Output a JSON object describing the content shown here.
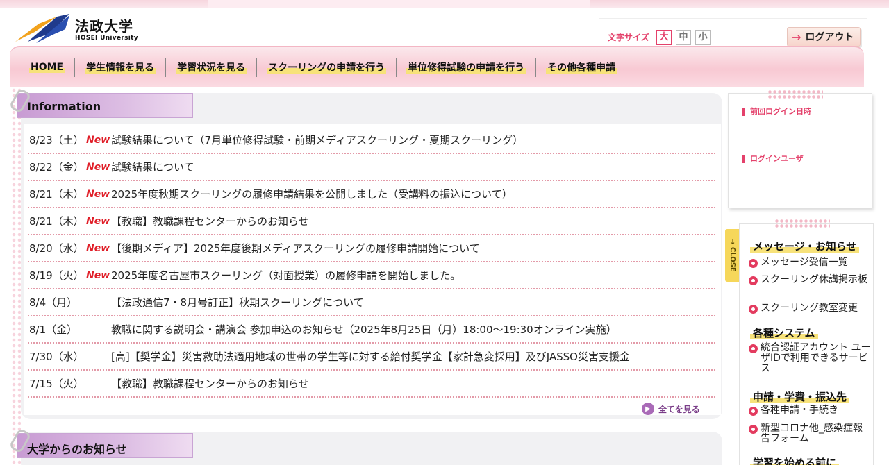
{
  "header": {
    "logo_main": "法政大学",
    "logo_sub": "HOSEI University",
    "fontsize_label": "文字サイズ",
    "fontsize_options": [
      "大",
      "中",
      "小"
    ],
    "logout_label": "ログアウト"
  },
  "nav": {
    "items": [
      {
        "label": "HOME"
      },
      {
        "label": "学生情報を見る"
      },
      {
        "label": "学習状況を見る"
      },
      {
        "label": "スクーリングの申請を行う"
      },
      {
        "label": "単位修得試験の申請を行う"
      },
      {
        "label": "その他各種申請"
      }
    ]
  },
  "information": {
    "heading": "Information",
    "new_badge": "New",
    "items": [
      {
        "date": "8/23（土）",
        "is_new": true,
        "title": "試験結果について（7月単位修得試験・前期メディアスクーリング・夏期スクーリング）"
      },
      {
        "date": "8/22（金）",
        "is_new": true,
        "title": "試験結果について"
      },
      {
        "date": "8/21（木）",
        "is_new": true,
        "title": "2025年度秋期スクーリングの履修申請結果を公開しました（受講料の振込について）"
      },
      {
        "date": "8/21（木）",
        "is_new": true,
        "title": "【教職】教職課程センターからのお知らせ"
      },
      {
        "date": "8/20（水）",
        "is_new": true,
        "title": "【後期メディア】2025年度後期メディアスクーリングの履修申請開始について"
      },
      {
        "date": "8/19（火）",
        "is_new": true,
        "title": "2025年度名古屋市スクーリング（対面授業）の履修申請を開始しました。"
      },
      {
        "date": "8/4（月）",
        "is_new": false,
        "title": "【法政通信7・8月号訂正】秋期スクーリングについて"
      },
      {
        "date": "8/1（金）",
        "is_new": false,
        "title": "教職に関する説明会・講演会 参加申込のお知らせ（2025年8月25日（月）18:00〜19:30オンライン実施）"
      },
      {
        "date": "7/30（水）",
        "is_new": false,
        "title": "[高]【奨学金】災害救助法適用地域の世帯の学生等に対する給付奨学金【家計急変採用】及びJASSO災害支援金"
      },
      {
        "date": "7/15（火）",
        "is_new": false,
        "title": "【教職】教職課程センターからのお知らせ"
      }
    ],
    "see_all": "全てを見る"
  },
  "university_news": {
    "heading": "大学からのお知らせ"
  },
  "login_card": {
    "last_login_label": "前回ログイン日時",
    "login_user_label": "ログインユーザ"
  },
  "close_tab": "→ CLOSE",
  "side_menu": {
    "sections": [
      {
        "heading": "メッセージ・お知らせ",
        "links": [
          "メッセージ受信一覧",
          "スクーリング休講掲示板",
          "スクーリング教室変更"
        ]
      },
      {
        "heading": "各種システム",
        "links": [
          "統合認証アカウント ユーザIDで利用できるサービス"
        ]
      },
      {
        "heading": "申請・学費・振込先",
        "links": [
          "各種申請・手続き",
          "新型コロナ他_感染症報告フォーム"
        ]
      },
      {
        "heading": "学習を始める前に",
        "links": []
      }
    ]
  },
  "colors": {
    "accent_pink": "#e4416b",
    "new_red": "#e01e28",
    "tab_purple": "#c89bd3",
    "highlight_yellow": "#f7e27a"
  }
}
